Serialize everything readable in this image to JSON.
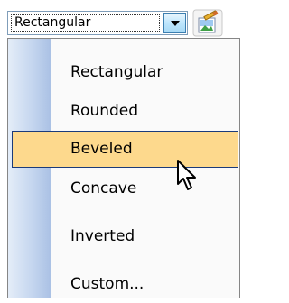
{
  "combo": {
    "value": "Rectangular",
    "dropdown_icon": "chevron-down-icon"
  },
  "toolbar": {
    "tool_icon": "format-picture-icon"
  },
  "menu": {
    "items": [
      {
        "label": "Rectangular"
      },
      {
        "label": "Rounded"
      },
      {
        "label": "Beveled",
        "highlighted": true
      },
      {
        "label": "Concave"
      },
      {
        "label": "Inverted"
      },
      {
        "label": "Custom..."
      }
    ]
  },
  "colors": {
    "highlight_fill": "#fdd98d",
    "highlight_border": "#1b3b7a",
    "combo_border": "#7f9db9"
  },
  "cursor_icon": "pointer-arrow-icon"
}
